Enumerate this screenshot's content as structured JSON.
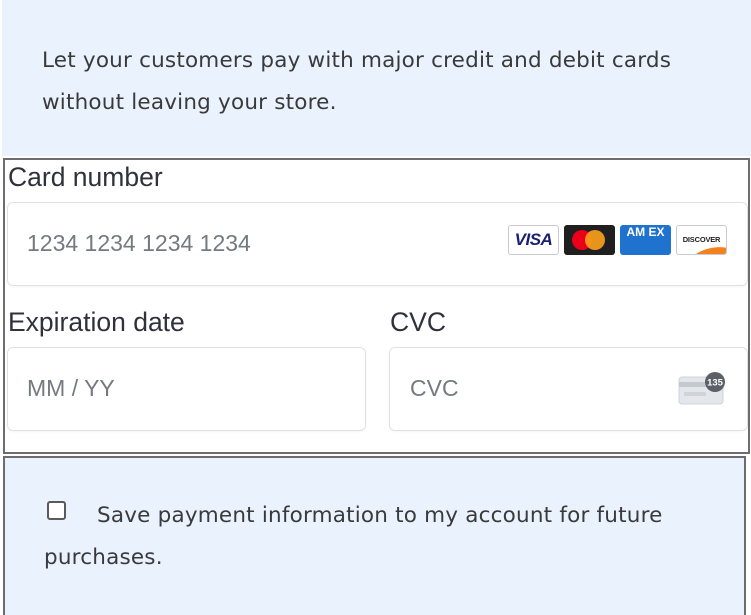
{
  "intro": {
    "text": "Let your customers pay with major credit and debit cards without leaving your store."
  },
  "form": {
    "card_number": {
      "label": "Card number",
      "placeholder": "1234 1234 1234 1234",
      "value": ""
    },
    "brands": {
      "visa": "VISA",
      "amex": "AM EX",
      "discover": "DISCOVER"
    },
    "expiration": {
      "label": "Expiration date",
      "placeholder": "MM / YY",
      "value": ""
    },
    "cvc": {
      "label": "CVC",
      "placeholder": "CVC",
      "value": "",
      "icon_text": "135"
    }
  },
  "save": {
    "checked": false,
    "label": "Save payment information to my account for future purchases."
  },
  "colors": {
    "panel_bg": "#e9f2fd",
    "label_text": "#30313d",
    "placeholder_text": "#747a80",
    "border": "#6d6d6d"
  }
}
